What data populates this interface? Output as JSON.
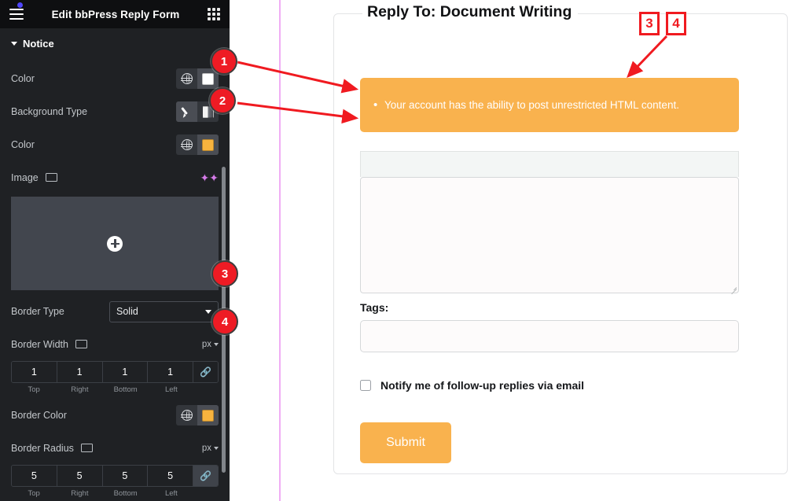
{
  "sidebar": {
    "header": {
      "title": "Edit bbPress Reply Form",
      "menu_icon": "hamburger-icon",
      "apps_icon": "grid-apps-icon",
      "notification_dot": true
    },
    "section": {
      "label": "Notice",
      "expanded": true
    },
    "controls": [
      {
        "id": "notice-color",
        "label": "Color",
        "type": "color",
        "global_icon": "globe-icon",
        "swatch": "#ffffff"
      },
      {
        "id": "background-type",
        "label": "Background Type",
        "type": "toggle",
        "options": [
          "classic",
          "gradient"
        ],
        "selected": "classic"
      },
      {
        "id": "background-color",
        "label": "Color",
        "type": "color",
        "global_icon": "globe-icon",
        "swatch": "#f7b33e"
      },
      {
        "id": "background-image",
        "label": "Image",
        "type": "media",
        "responsive_icon": "monitor-icon",
        "ai_icon": "sparkle-icon"
      },
      {
        "id": "border-type",
        "label": "Border Type",
        "type": "select",
        "value": "Solid"
      },
      {
        "id": "border-width",
        "label": "Border Width",
        "type": "dimensions",
        "unit": "px",
        "responsive_icon": "monitor-icon",
        "values": [
          "1",
          "1",
          "1",
          "1"
        ],
        "sides": [
          "Top",
          "Right",
          "Bottom",
          "Left"
        ],
        "linked": false
      },
      {
        "id": "border-color",
        "label": "Border Color",
        "type": "color",
        "global_icon": "globe-icon",
        "swatch": "#f7b33e"
      },
      {
        "id": "border-radius",
        "label": "Border Radius",
        "type": "dimensions",
        "unit": "px",
        "responsive_icon": "monitor-icon",
        "values": [
          "5",
          "5",
          "5",
          "5"
        ],
        "sides": [
          "Top",
          "Right",
          "Bottom",
          "Left"
        ],
        "linked": true
      }
    ]
  },
  "preview": {
    "legend": "Reply To: Document Writing",
    "notice": {
      "items": [
        "Your account has the ability to post unrestricted HTML content."
      ],
      "background": "#f9b24e",
      "text_color": "#ffffff"
    },
    "editor": {
      "toolbar_label": "",
      "content": "",
      "placeholder": ""
    },
    "tags": {
      "label": "Tags:",
      "value": "",
      "placeholder": ""
    },
    "notify": {
      "label": "Notify me of follow-up replies via email",
      "checked": false
    },
    "submit": {
      "label": "Submit",
      "color": "#f9b24e"
    }
  },
  "annotations": {
    "accent_circle": "#ee1b24",
    "accent_square": "#f01a20",
    "circles": [
      {
        "n": "1",
        "target": "notice-color-swatch"
      },
      {
        "n": "2",
        "target": "background-type-toggle"
      },
      {
        "n": "3",
        "target": "border-type-select"
      },
      {
        "n": "4",
        "target": "border-width-unit"
      }
    ],
    "squares": [
      {
        "n": "3",
        "target": "notice-border"
      },
      {
        "n": "4",
        "target": "notice-border"
      }
    ]
  }
}
